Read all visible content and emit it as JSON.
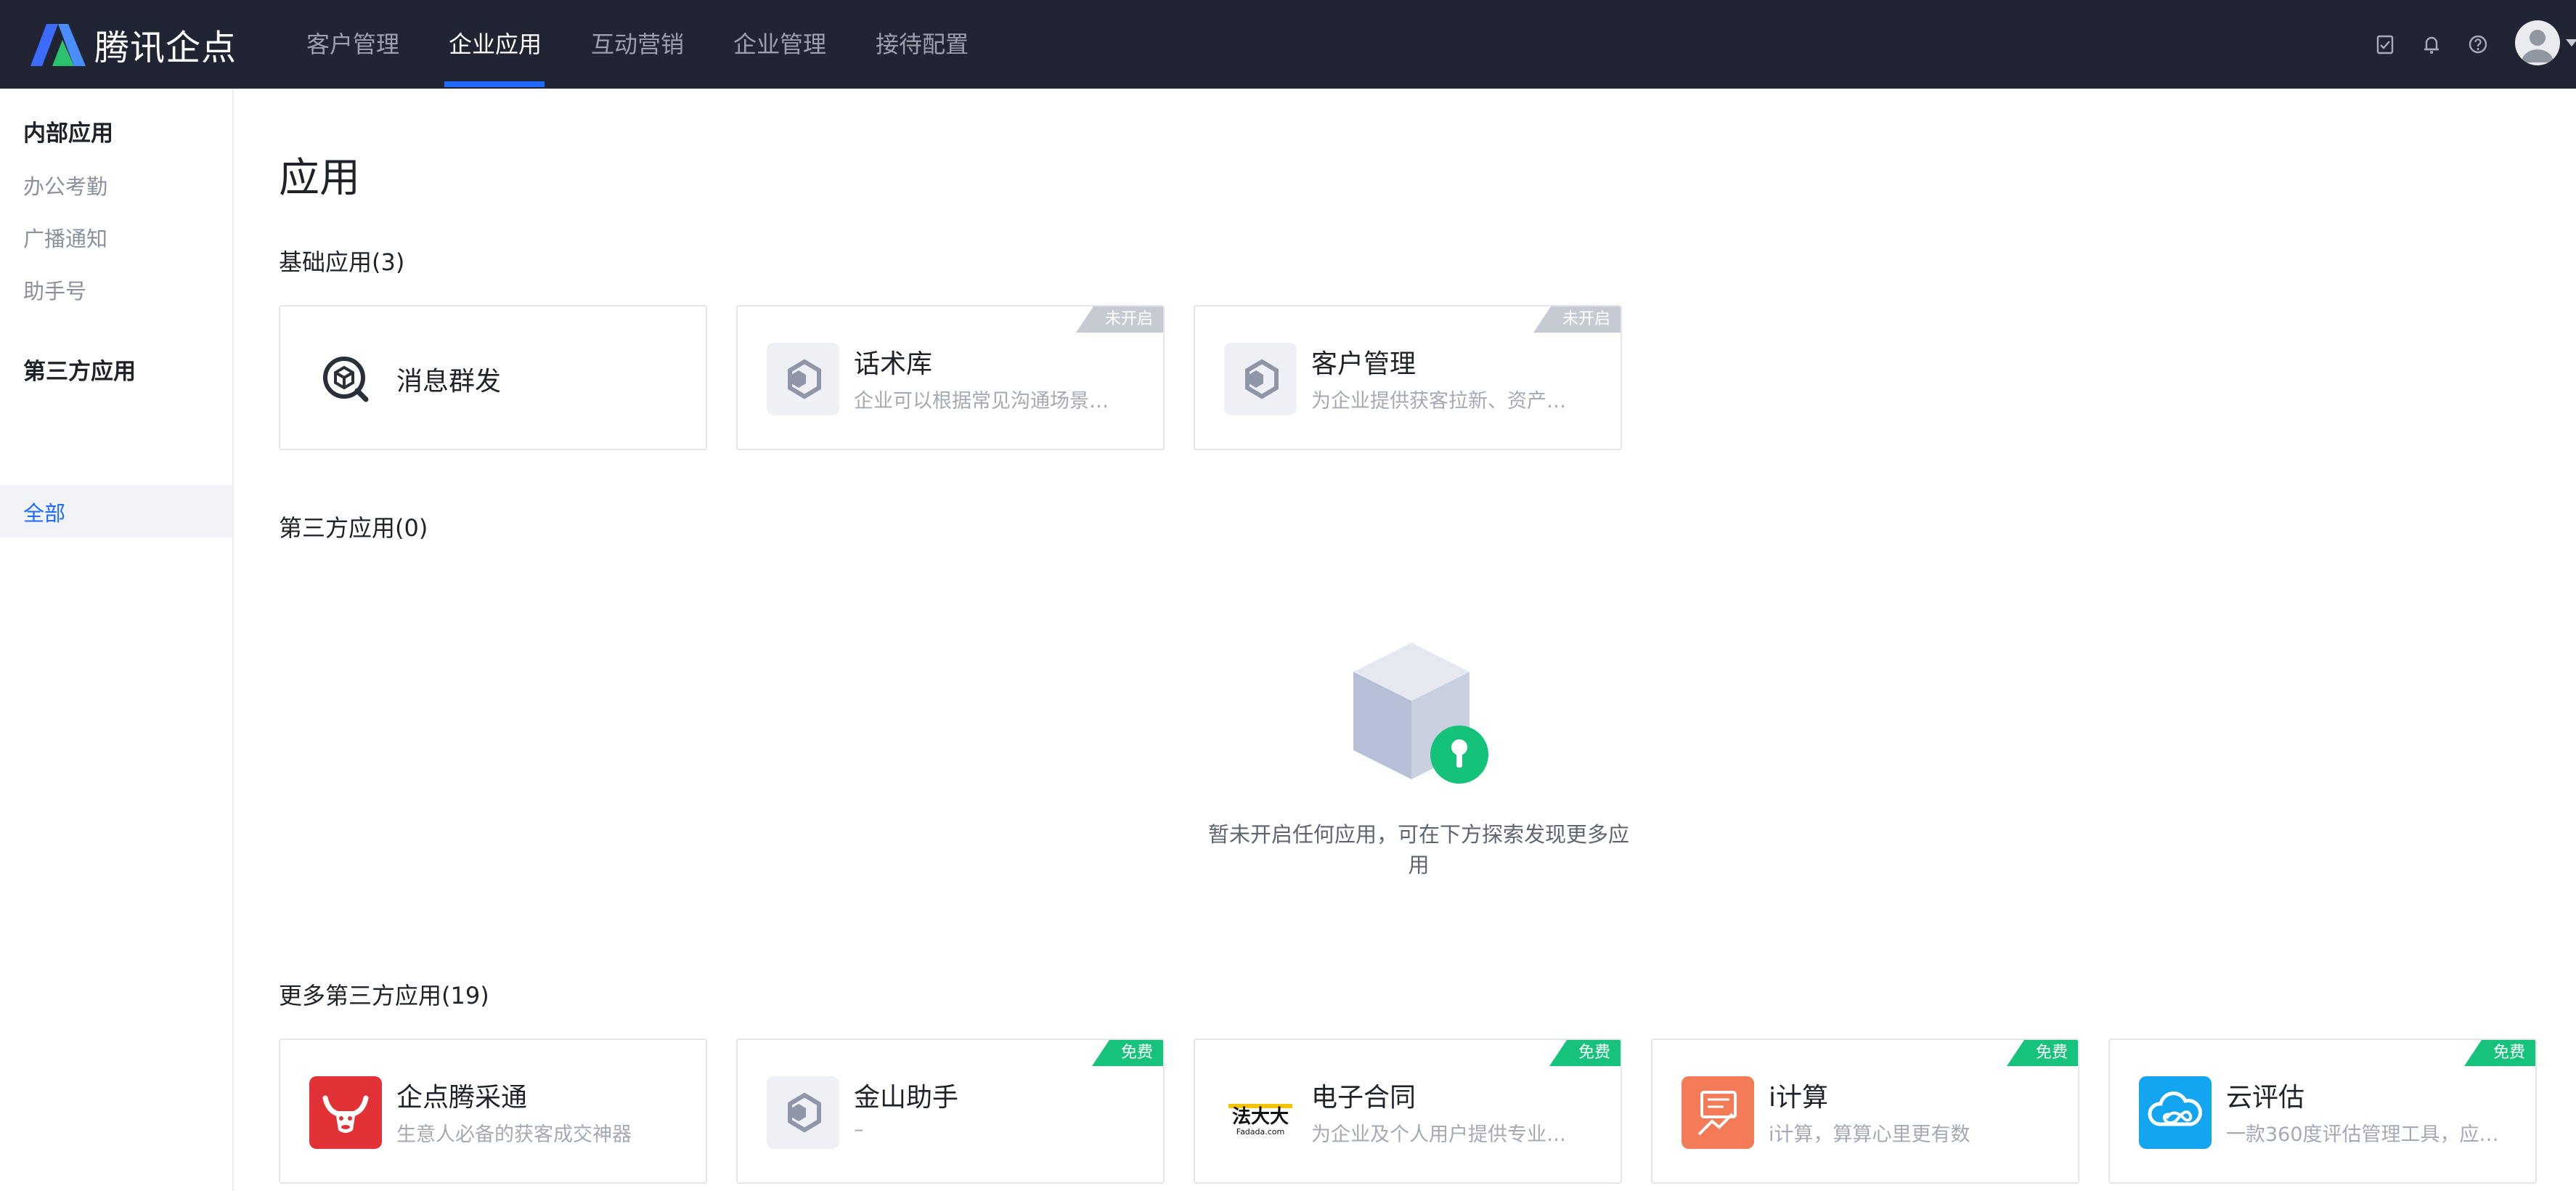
{
  "brand": {
    "name": "腾讯企点"
  },
  "nav": {
    "items": [
      {
        "label": "客户管理"
      },
      {
        "label": "企业应用"
      },
      {
        "label": "互动营销"
      },
      {
        "label": "企业管理"
      },
      {
        "label": "接待配置"
      }
    ],
    "active_index": 1,
    "tools": [
      {
        "icon": "checklist-icon"
      },
      {
        "icon": "bell-icon"
      },
      {
        "icon": "help-icon"
      }
    ],
    "user_icon": "avatar-icon"
  },
  "sidebar": {
    "group_internal": "内部应用",
    "internal_items": [
      {
        "label": "办公考勤"
      },
      {
        "label": "广播通知"
      },
      {
        "label": "助手号"
      }
    ],
    "group_third": "第三方应用",
    "third_items": [
      {
        "label": "全部",
        "active": true
      }
    ]
  },
  "main": {
    "title": "应用",
    "basic_section": "基础应用(3)",
    "basic_apps": [
      {
        "name": "消息群发",
        "desc": "",
        "tag": "",
        "icon": "message-broadcast-icon"
      },
      {
        "name": "话术库",
        "desc": "企业可以根据常见沟通场景…",
        "tag": "未开启",
        "icon": "hexagon-app-icon"
      },
      {
        "name": "客户管理",
        "desc": "为企业提供获客拉新、资产…",
        "tag": "未开启",
        "icon": "hexagon-app-icon"
      }
    ],
    "third_section": "第三方应用(0)",
    "empty_text": "暂未开启任何应用，可在下方探索发现更多应用",
    "more_section": "更多第三方应用(19)",
    "more_apps": [
      {
        "name": "企点腾采通",
        "desc": "生意人必备的获客成交神器",
        "tag": "",
        "icon": "bull-logo-icon"
      },
      {
        "name": "金山助手",
        "desc": "–",
        "tag": "免费",
        "icon": "hexagon-app-icon"
      },
      {
        "name": "电子合同",
        "desc": "为企业及个人用户提供专业…",
        "tag": "免费",
        "icon": "fadada-logo-icon",
        "logo_text": "法大大",
        "logo_sub": "Fadada.com"
      },
      {
        "name": "i计算",
        "desc": "i计算，算算心里更有数",
        "tag": "免费",
        "icon": "chart-board-icon"
      },
      {
        "name": "云评估",
        "desc": "一款360度评估管理工具，应…",
        "tag": "免费",
        "icon": "cloud-infinity-icon"
      }
    ]
  },
  "colors": {
    "topbar": "#212533",
    "accent": "#1f6bff",
    "free_tag": "#16c27c",
    "off_tag": "#c5cad3"
  }
}
